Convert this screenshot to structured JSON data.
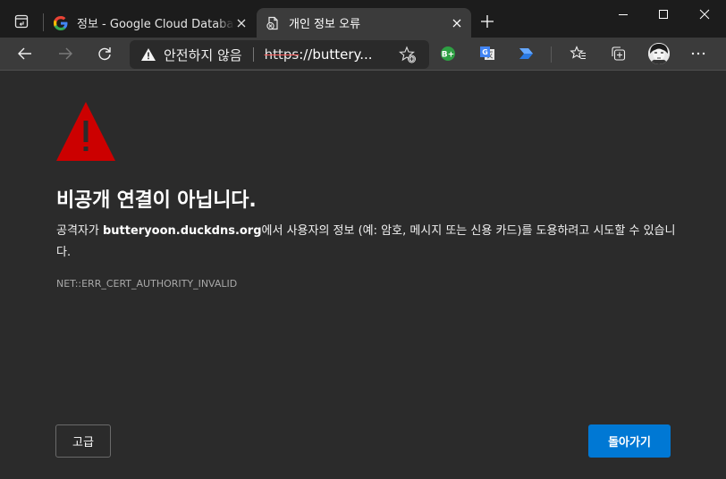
{
  "tabs": [
    {
      "title": "정보 - Google Cloud Database W",
      "favicon": "google-g-icon",
      "active": false
    },
    {
      "title": "개인 정보 오류",
      "favicon": "page-error-icon",
      "active": true
    }
  ],
  "window_controls": [
    "minimize",
    "maximize",
    "close"
  ],
  "toolbar": {
    "security_label": "안전하지 않음",
    "url_scheme": "https",
    "url_rest": "://buttery...",
    "extensions": [
      {
        "name": "b-plus-extension",
        "label": "B+",
        "color": "#2ea043"
      },
      {
        "name": "google-translate-extension",
        "label": "G",
        "color": "#4285f4"
      },
      {
        "name": "power-automate-extension",
        "label": "",
        "color": "#2b7ae4"
      }
    ]
  },
  "content": {
    "heading": "비공개 연결이 아닙니다.",
    "desc_prefix": "공격자가 ",
    "desc_domain": "butteryoon.duckdns.org",
    "desc_suffix": "에서 사용자의 정보 (예: 암호, 메시지 또는 신용 카드)를 도용하려고 시도할 수 있습니다.",
    "error_code": "NET::ERR_CERT_AUTHORITY_INVALID",
    "advanced_label": "고급",
    "back_label": "돌아가기"
  },
  "colors": {
    "warning_red": "#cc0000",
    "primary_blue": "#0078d4",
    "background": "#2b2b2b"
  }
}
